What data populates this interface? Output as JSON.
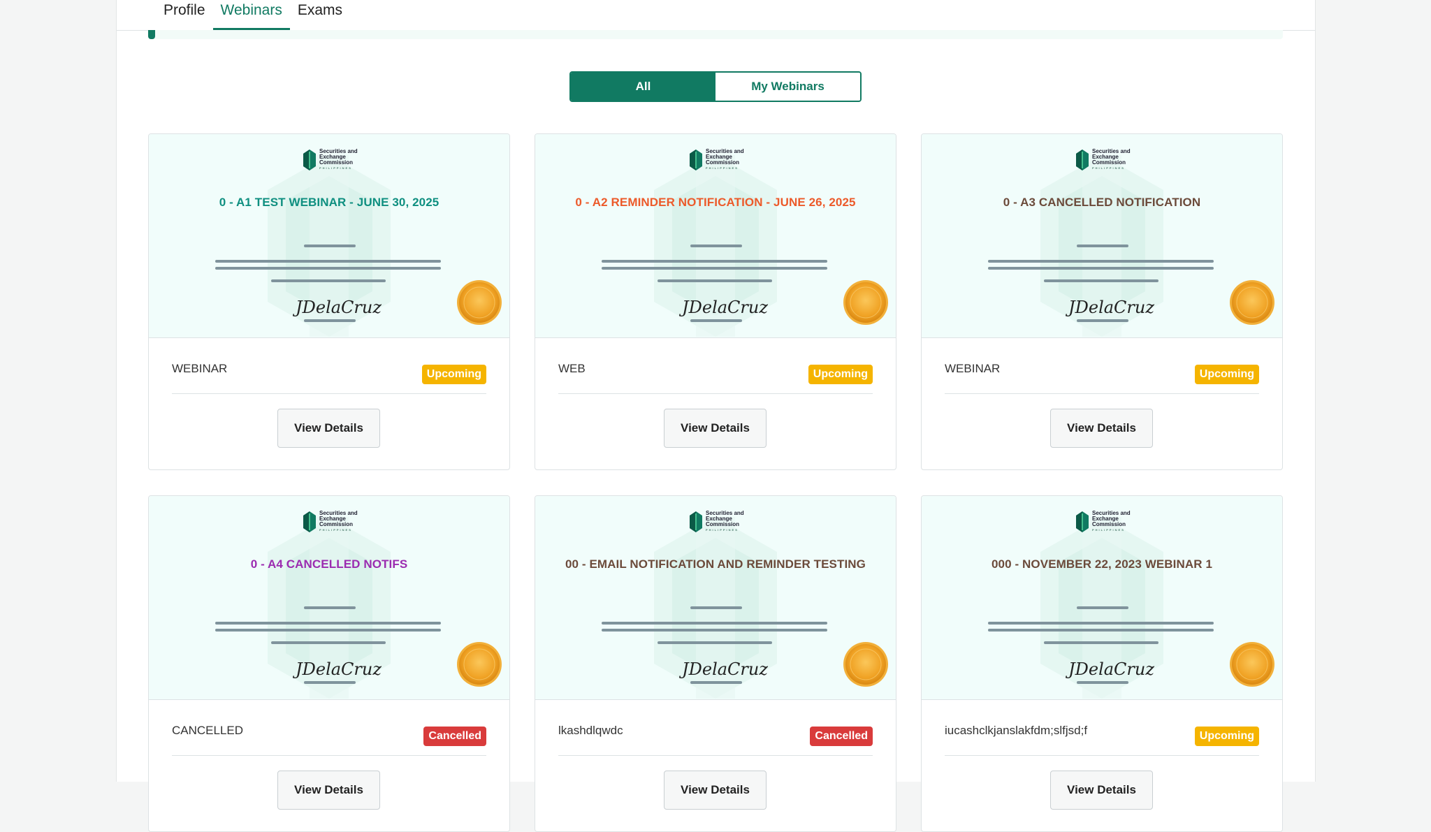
{
  "tabs": [
    {
      "label": "Profile"
    },
    {
      "label": "Webinars"
    },
    {
      "label": "Exams"
    }
  ],
  "progress": {
    "value_fraction": 0.006
  },
  "filter": {
    "all_label": "All",
    "mine_label": "My Webinars"
  },
  "colors": {
    "brand": "#117a62",
    "upcoming": "#f5b400",
    "cancelled": "#d93b3b"
  },
  "cards": [
    {
      "title": "0 - A1 TEST WEBINAR - JUNE 30, 2025",
      "title_color": "#0f8f80",
      "type": "WEBINAR",
      "status": "Upcoming",
      "status_kind": "upcoming",
      "button": "View Details"
    },
    {
      "title": "0 - A2 REMINDER NOTIFICATION - JUNE 26, 2025",
      "title_color": "#ec5a2a",
      "type": "WEB",
      "status": "Upcoming",
      "status_kind": "upcoming",
      "button": "View Details"
    },
    {
      "title": "0 - A3 CANCELLED NOTIFICATION",
      "title_color": "#6b4a3a",
      "type": "WEBINAR",
      "status": "Upcoming",
      "status_kind": "upcoming",
      "button": "View Details"
    },
    {
      "title": "0 - A4 CANCELLED NOTIFS",
      "title_color": "#9b2bb0",
      "type": "CANCELLED",
      "status": "Cancelled",
      "status_kind": "cancelled",
      "button": "View Details"
    },
    {
      "title": "00 - EMAIL NOTIFICATION AND REMINDER TESTING",
      "title_color": "#6b4a3a",
      "type": "lkashdlqwdc",
      "status": "Cancelled",
      "status_kind": "cancelled",
      "button": "View Details"
    },
    {
      "title": "000 - NOVEMBER 22, 2023 WEBINAR 1",
      "title_color": "#6b4a3a",
      "type": "iucashclkjanslakfdm;slfjsd;f",
      "status": "Upcoming",
      "status_kind": "upcoming",
      "button": "View Details"
    }
  ],
  "cert": {
    "logo_line1": "Securities and",
    "logo_line2": "Exchange",
    "logo_line3": "Commission",
    "logo_sub": "PHILIPPINES",
    "signature": "JDelaCruz",
    "seal_icon": "gold-seal-icon"
  }
}
